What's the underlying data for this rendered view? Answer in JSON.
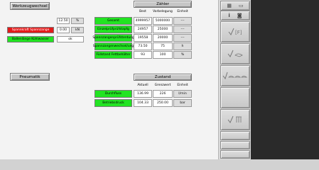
{
  "werkzeugwechsel": {
    "title": "Werkzeugwechsel",
    "value_a": "12.50",
    "unit_a": "%",
    "spannkraft_label": "Spannkraft Spannzange",
    "spannkraft_value": "0.00",
    "spannkraft_unit": "kN",
    "ballenlaenge_label": "Ballenlänge Kühlwasser",
    "ballenlaenge_value": "ok"
  },
  "zaehler": {
    "title": "Zähler",
    "headers": [
      "Best",
      "Vorbelegung",
      "Einheit"
    ],
    "rows": [
      {
        "label": "Gesamt",
        "best": "4999957",
        "vor": "5000000",
        "unit": "---"
      },
      {
        "label": "Einzelprüfprüfstapfg",
        "best": "24957",
        "vor": "25000",
        "unit": "---"
      },
      {
        "label": "Spannzangenprüfstentung",
        "best": "19558",
        "vor": "20000",
        "unit": "---"
      },
      {
        "label": "Spannzangenwechsel/ung",
        "best": "73.50",
        "vor": "75",
        "unit": "h"
      },
      {
        "label": "Füllstand Fettbehälter",
        "best": "93",
        "vor": "100",
        "unit": "%"
      }
    ]
  },
  "pneumatik": {
    "title": "Pneumatik",
    "zustand_title": "Zustand",
    "headers": [
      "Aktuell",
      "Grenzwert",
      "Einheit"
    ],
    "rows": [
      {
        "label": "Durchfluss",
        "aktuell": "136.99",
        "grenz": "226",
        "unit": "l/min"
      },
      {
        "label": "Betriebsdruck",
        "aktuell": "104.33",
        "grenz": "250.00",
        "unit": "bar"
      }
    ]
  },
  "sidebar": {
    "top_icons": [
      "grid-icon",
      "monitor-icon",
      "info-icon",
      "camera-icon"
    ],
    "buttons": [
      "check-f-icon",
      "oil-check-icon",
      "multi-oil-check-icon",
      "check-flow-icon"
    ]
  }
}
